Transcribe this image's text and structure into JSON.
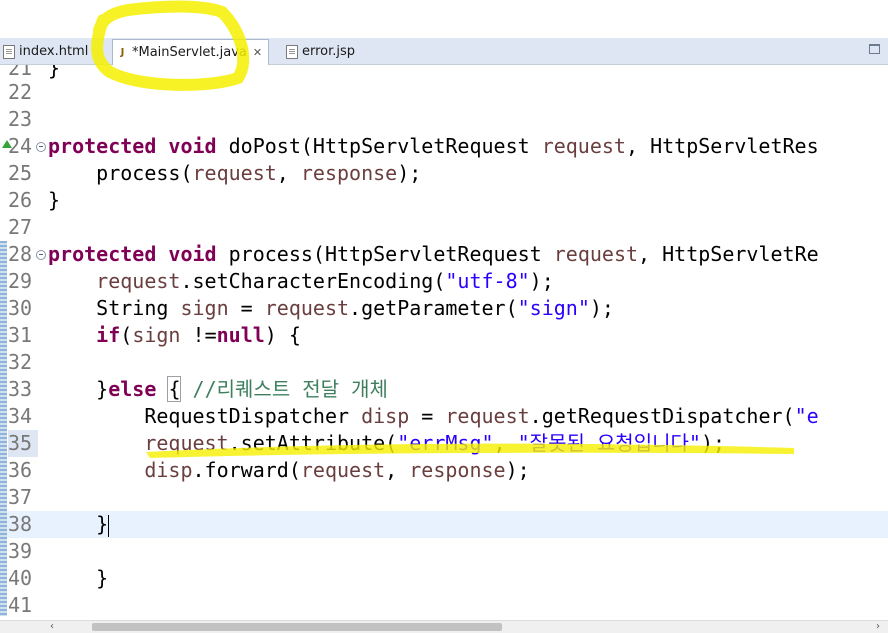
{
  "tabs": [
    {
      "label": "index.html",
      "icon": "html-file-icon"
    },
    {
      "label": "*MainServlet.java",
      "icon": "java-file-icon",
      "active": true
    },
    {
      "label": "error.jsp",
      "icon": "jsp-file-icon"
    }
  ],
  "tab_close_glyph": "✕",
  "lines": [
    {
      "n": "21"
    },
    {
      "n": "22"
    },
    {
      "n": "23"
    },
    {
      "n": "24"
    },
    {
      "n": "25"
    },
    {
      "n": "26"
    },
    {
      "n": "27"
    },
    {
      "n": "28"
    },
    {
      "n": "29"
    },
    {
      "n": "30"
    },
    {
      "n": "31"
    },
    {
      "n": "32"
    },
    {
      "n": "33"
    },
    {
      "n": "34"
    },
    {
      "n": "35"
    },
    {
      "n": "36"
    },
    {
      "n": "37"
    },
    {
      "n": "38"
    },
    {
      "n": "39"
    },
    {
      "n": "40"
    },
    {
      "n": "41"
    }
  ],
  "code": {
    "l21": "}",
    "l24_kw": "protected void",
    "l24_m": " doPost(HttpServletRequest ",
    "l24_v": "request",
    "l24_rest": ", HttpServletRes",
    "l25_a": "    process(",
    "l25_v1": "request",
    "l25_b": ", ",
    "l25_v2": "response",
    "l25_c": ");",
    "l26": "}",
    "l28_kw": "protected void",
    "l28_m": " process(HttpServletRequest ",
    "l28_v": "request",
    "l28_rest": ", HttpServletRe",
    "l29_v": "    request",
    "l29_m": ".setCharacterEncoding(",
    "l29_s": "\"utf-8\"",
    "l29_e": ");",
    "l30_a": "    String ",
    "l30_v": "sign",
    "l30_b": " = ",
    "l30_v2": "request",
    "l30_m": ".getParameter(",
    "l30_s": "\"sign\"",
    "l30_e": ");",
    "l31_kw": "if",
    "l31_a": "(",
    "l31_v": "sign",
    "l31_b": " !=",
    "l31_kw2": "null",
    "l31_c": ") {",
    "l33_a": "}",
    "l33_kw": "else",
    "l33_brace": "{",
    "l33_cm": "//리퀘스트 전달 개체",
    "l34_a": "        RequestDispatcher ",
    "l34_v": "disp",
    "l34_b": " = ",
    "l34_v2": "request",
    "l34_m": ".getRequestDispatcher(",
    "l34_s": "\"e",
    "l35_v": "        request",
    "l35_m": ".setAttribute(",
    "l35_s1": "\"errMsg\"",
    "l35_b": ", ",
    "l35_s2": "\"잘못된 요청입니다\"",
    "l35_e": ");",
    "l36_v": "        disp",
    "l36_m": ".forward(",
    "l36_v2": "request",
    "l36_b": ", ",
    "l36_v3": "response",
    "l36_e": ");",
    "l38": "    }",
    "l40": "    }"
  },
  "colors": {
    "keyword": "#7f0055",
    "string": "#2a00ff",
    "comment": "#3f7f5f",
    "variable": "#6a3e3e",
    "annotation_highlight": "#f5f000",
    "current_line": "#e8f2fe"
  },
  "scroll_arrows": {
    "left": "‹",
    "right": "›"
  }
}
